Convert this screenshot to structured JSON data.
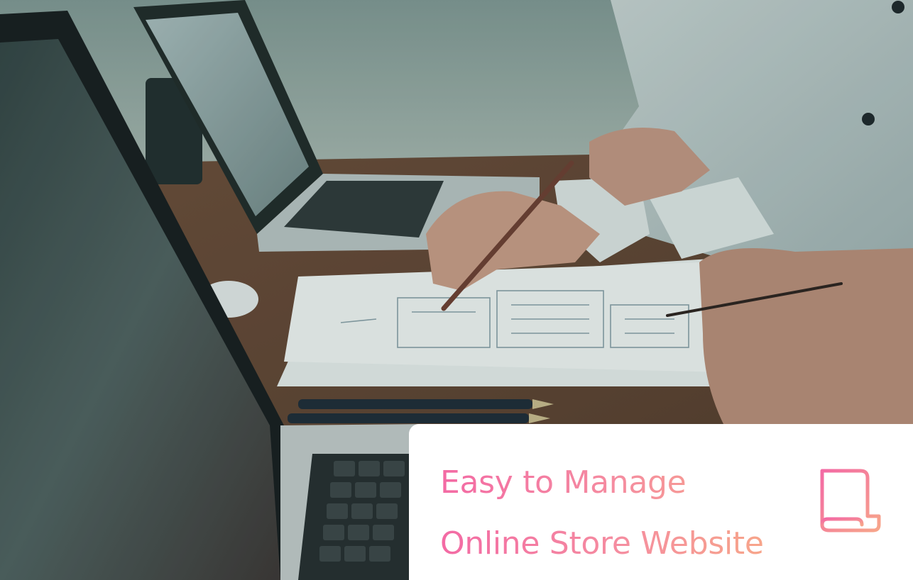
{
  "caption": {
    "line1": "Easy to Manage",
    "line2": "Online Store Website",
    "icon": "document-icon"
  },
  "colors": {
    "gradient_start": "#f36aa4",
    "gradient_end": "#f7a58a",
    "card_bg": "#ffffff"
  }
}
